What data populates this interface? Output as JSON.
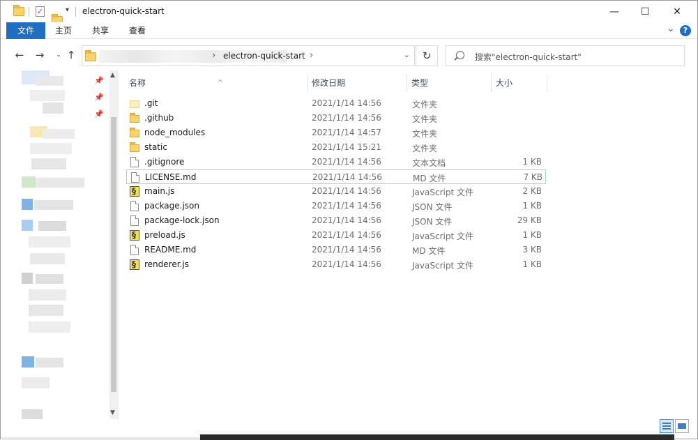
{
  "window": {
    "title": "electron-quick-start",
    "minimize_glyph": "—",
    "maximize_glyph": "☐",
    "close_glyph": "✕"
  },
  "ribbon": {
    "tabs": [
      {
        "label": "文件",
        "active": true
      },
      {
        "label": "主页"
      },
      {
        "label": "共享"
      },
      {
        "label": "查看"
      }
    ],
    "expand_glyph": "⌄",
    "help_glyph": "?"
  },
  "address": {
    "current_segment": "electron-quick-start",
    "search_placeholder": "搜索\"electron-quick-start\""
  },
  "columns": {
    "name": "名称",
    "date": "修改日期",
    "type": "类型",
    "size": "大小"
  },
  "files": [
    {
      "name": ".git",
      "date": "2021/1/14 14:56",
      "type": "文件夹",
      "size": "",
      "icon": "folder-faded-icon"
    },
    {
      "name": ".github",
      "date": "2021/1/14 14:56",
      "type": "文件夹",
      "size": "",
      "icon": "folder-icon"
    },
    {
      "name": "node_modules",
      "date": "2021/1/14 14:57",
      "type": "文件夹",
      "size": "",
      "icon": "folder-icon"
    },
    {
      "name": "static",
      "date": "2021/1/14 15:21",
      "type": "文件夹",
      "size": "",
      "icon": "folder-icon"
    },
    {
      "name": ".gitignore",
      "date": "2021/1/14 14:56",
      "type": "文本文档",
      "size": "1 KB",
      "icon": "file-icon"
    },
    {
      "name": "LICENSE.md",
      "date": "2021/1/14 14:56",
      "type": "MD 文件",
      "size": "7 KB",
      "icon": "file-icon",
      "selected": true
    },
    {
      "name": "main.js",
      "date": "2021/1/14 14:56",
      "type": "JavaScript 文件",
      "size": "2 KB",
      "icon": "js-file-icon"
    },
    {
      "name": "package.json",
      "date": "2021/1/14 14:56",
      "type": "JSON 文件",
      "size": "1 KB",
      "icon": "file-icon"
    },
    {
      "name": "package-lock.json",
      "date": "2021/1/14 14:56",
      "type": "JSON 文件",
      "size": "29 KB",
      "icon": "file-icon"
    },
    {
      "name": "preload.js",
      "date": "2021/1/14 14:56",
      "type": "JavaScript 文件",
      "size": "1 KB",
      "icon": "js-file-icon"
    },
    {
      "name": "README.md",
      "date": "2021/1/14 14:56",
      "type": "MD 文件",
      "size": "3 KB",
      "icon": "file-icon"
    },
    {
      "name": "renderer.js",
      "date": "2021/1/14 14:56",
      "type": "JavaScript 文件",
      "size": "1 KB",
      "icon": "js-file-icon"
    }
  ],
  "colors": {
    "accent": "#1e6fc4",
    "selection_border": "#99d1ff",
    "folder": "#f7d36a"
  }
}
